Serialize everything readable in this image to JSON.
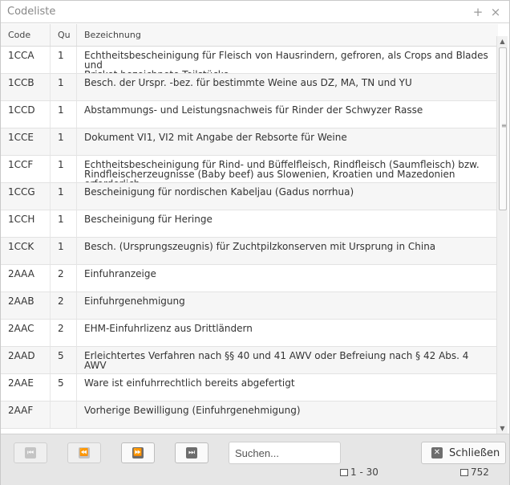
{
  "window": {
    "title": "Codeliste",
    "add_icon": "+",
    "close_icon": "×"
  },
  "columns": {
    "code": "Code",
    "qty": "Qu",
    "desc": "Bezeichnung"
  },
  "rows": [
    {
      "code": "1CCA",
      "qty": "1",
      "desc1": "Echtheitsbescheinigung für Fleisch von Hausrindern, gefroren, als Crops and Blades und",
      "desc2": "Brisket bezeichnete Teilstücke"
    },
    {
      "code": "1CCB",
      "qty": "1",
      "desc1": "Besch. der Urspr. -bez. für bestimmte Weine aus DZ, MA, TN und YU",
      "desc2": ""
    },
    {
      "code": "1CCD",
      "qty": "1",
      "desc1": "Abstammungs- und Leistungsnachweis für Rinder der Schwyzer Rasse",
      "desc2": ""
    },
    {
      "code": "1CCE",
      "qty": "1",
      "desc1": "Dokument VI1, VI2 mit Angabe der Rebsorte für Weine",
      "desc2": ""
    },
    {
      "code": "1CCF",
      "qty": "1",
      "desc1": "Echtheitsbescheinigung für Rind- und Büffelfleisch, Rindfleisch (Saumfleisch) bzw.",
      "desc2": "Rindfleischerzeugnisse (Baby beef) aus Slowenien, Kroatien und Mazedonien erforderlich"
    },
    {
      "code": "1CCG",
      "qty": "1",
      "desc1": "Bescheinigung für nordischen Kabeljau (Gadus norrhua)",
      "desc2": ""
    },
    {
      "code": "1CCH",
      "qty": "1",
      "desc1": "Bescheinigung für Heringe",
      "desc2": ""
    },
    {
      "code": "1CCK",
      "qty": "1",
      "desc1": "Besch. (Ursprungszeugnis) für Zuchtpilzkonserven mit Ursprung in China",
      "desc2": ""
    },
    {
      "code": "2AAA",
      "qty": "2",
      "desc1": "Einfuhranzeige",
      "desc2": ""
    },
    {
      "code": "2AAB",
      "qty": "2",
      "desc1": "Einfuhrgenehmigung",
      "desc2": ""
    },
    {
      "code": "2AAC",
      "qty": "2",
      "desc1": "EHM-Einfuhrlizenz aus Drittländern",
      "desc2": ""
    },
    {
      "code": "2AAD",
      "qty": "5",
      "desc1": "Erleichtertes Verfahren nach §§ 40 und 41 AWV oder Befreiung nach § 42 Abs. 4 AWV",
      "desc2": ""
    },
    {
      "code": "2AAE",
      "qty": "5",
      "desc1": "Ware ist einfuhrrechtlich bereits abgefertigt",
      "desc2": ""
    },
    {
      "code": "2AAF",
      "qty": "",
      "desc1": "Vorherige Bewilligung (Einfuhrgenehmigung)",
      "desc2": ""
    }
  ],
  "footer": {
    "first_icon": "⏮",
    "prev_icon": "⏪",
    "next_icon": "⏩",
    "last_icon": "⏭",
    "search_placeholder": "Suchen...",
    "close_label": "Schließen",
    "close_icon": "✕",
    "range": "1 - 30",
    "total": "752"
  },
  "scrollbar": {
    "up": "▲",
    "down": "▼",
    "grip": "≡"
  }
}
